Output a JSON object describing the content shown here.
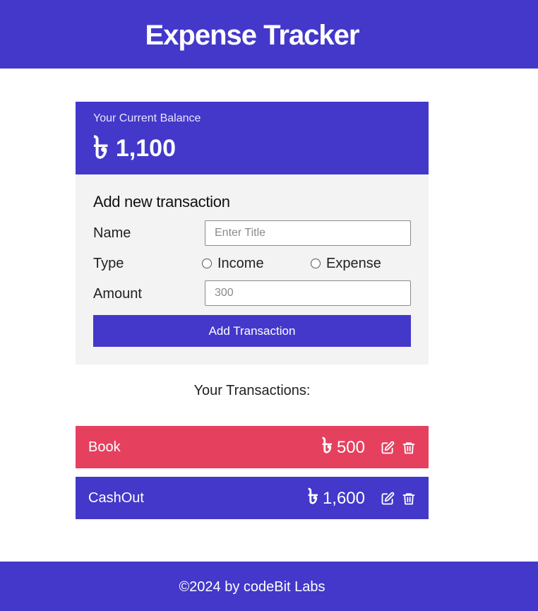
{
  "header": {
    "title": "Expense Tracker"
  },
  "balance": {
    "label": "Your Current Balance",
    "currency_symbol": "৳",
    "amount": "1,100"
  },
  "form": {
    "title": "Add new transaction",
    "name_label": "Name",
    "name_placeholder": "Enter Title",
    "type_label": "Type",
    "type_options": [
      "Income",
      "Expense"
    ],
    "amount_label": "Amount",
    "amount_placeholder": "300",
    "submit_label": "Add Transaction"
  },
  "transactions": {
    "heading": "Your Transactions:",
    "items": [
      {
        "name": "Book",
        "currency_symbol": "৳",
        "amount": "500",
        "type": "expense",
        "color": "#e5405e"
      },
      {
        "name": "CashOut",
        "currency_symbol": "৳",
        "amount": "1,600",
        "type": "income",
        "color": "#4338ca"
      }
    ]
  },
  "footer": {
    "text": "©2024 by codeBit Labs"
  },
  "colors": {
    "primary": "#4338ca",
    "expense": "#e5405e",
    "form_bg": "#f3f3f3"
  },
  "icons": [
    "edit-icon",
    "trash-icon"
  ]
}
